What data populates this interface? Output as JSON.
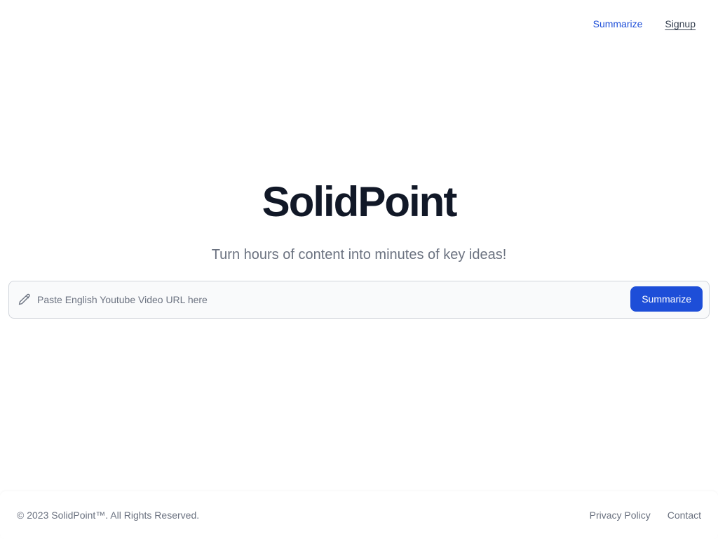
{
  "nav": {
    "summarize_label": "Summarize",
    "signup_label": "Signup"
  },
  "hero": {
    "title": "SolidPoint",
    "subtitle": "Turn hours of content into minutes of key ideas!"
  },
  "search": {
    "icon": "pencil-icon",
    "placeholder": "Paste English Youtube Video URL here",
    "value": "",
    "button_label": "Summarize"
  },
  "footer": {
    "copyright": "© 2023 SolidPoint™. All Rights Reserved.",
    "links": [
      "Privacy Policy",
      "Contact"
    ]
  },
  "colors": {
    "accent": "#1d4ed8",
    "title": "#111827",
    "muted": "#6b7280"
  }
}
